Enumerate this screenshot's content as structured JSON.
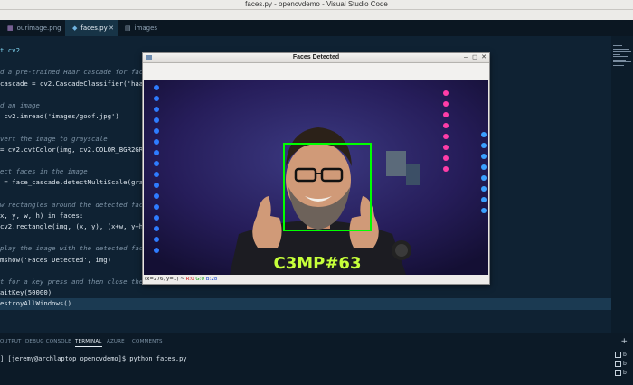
{
  "os_title": "faces.py - opencvdemo - Visual Studio Code",
  "tabs": [
    {
      "icon": "image-file-icon",
      "label": "ourimage.png",
      "active": false
    },
    {
      "icon": "python-file-icon",
      "label": "faces.py",
      "active": true
    },
    {
      "icon": "folder-icon",
      "label": "images",
      "active": false
    }
  ],
  "tab_close_glyph": "✕",
  "code_lines": [
    "t cv2",
    "",
    "d a pre-trained Haar cascade for face d",
    "cascade = cv2.CascadeClassifier('haarca",
    "",
    "d an image",
    " cv2.imread('images/goof.jpg')",
    "",
    "vert the image to grayscale",
    "= cv2.cvtColor(img, cv2.COLOR_BGR2GRAY)",
    "",
    "ect faces in the image",
    " = face_cascade.detectMultiScale(gray,",
    "",
    "w rectangles around the detected faces",
    "x, y, w, h) in faces:",
    "cv2.rectangle(img, (x, y), (x+w, y+h), (",
    "",
    "play the image with the detected faces",
    "mshow('Faces Detected', img)",
    "",
    "t for a key press and then close the wi",
    "aitKey(50000)",
    "estroyAllWindows()"
  ],
  "panel_tabs": [
    "OUTPUT",
    "DEBUG CONSOLE",
    "TERMINAL",
    "AZURE",
    "COMMENTS"
  ],
  "active_panel_tab": "TERMINAL",
  "terminal_line": "] [jeremy@archlaptop opencvdemo]$ python faces.py",
  "terminal_list": [
    "b",
    "b",
    "b"
  ],
  "panel_add": "+",
  "window": {
    "title": "Faces Detected",
    "minimize": "–",
    "maximize": "◻",
    "close": "✕",
    "status_prefix": "(x=276, y=1) ~ ",
    "status_r": "R:0",
    "status_g": "G:0",
    "status_b": "B:28",
    "shirt_text": "C3MP#63"
  },
  "colors": {
    "accent": "#00ff00",
    "editor_bg": "#0f2233"
  }
}
